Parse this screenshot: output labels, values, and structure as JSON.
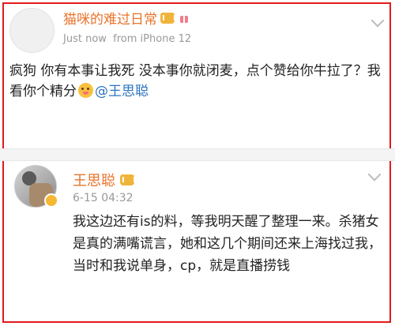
{
  "post1": {
    "username": "猫咪的难过日常",
    "time": "Just now",
    "source": "from iPhone 12",
    "text_before": "疯狗 你有本事让我死 没本事你就闭麦，点个赞给你牛拉了？我看你个精分",
    "mention": "@王思聪"
  },
  "post2": {
    "username": "王思聪",
    "time": "6-15 04:32",
    "text": "我这边还有is的料，等我明天醒了整理一来。杀猪女是真的满嘴谎言，她和这几个期间还来上海找过我，当时和我说单身，cp，就是直播捞钱"
  },
  "colors": {
    "border": "#e11a1a",
    "username": "#e8742c",
    "mention": "#2c74bf",
    "meta": "#999999"
  },
  "icons": [
    "vip-crown-icon",
    "gift-icon",
    "emoji-icon",
    "chevron-down-icon",
    "verified-badge-icon"
  ]
}
